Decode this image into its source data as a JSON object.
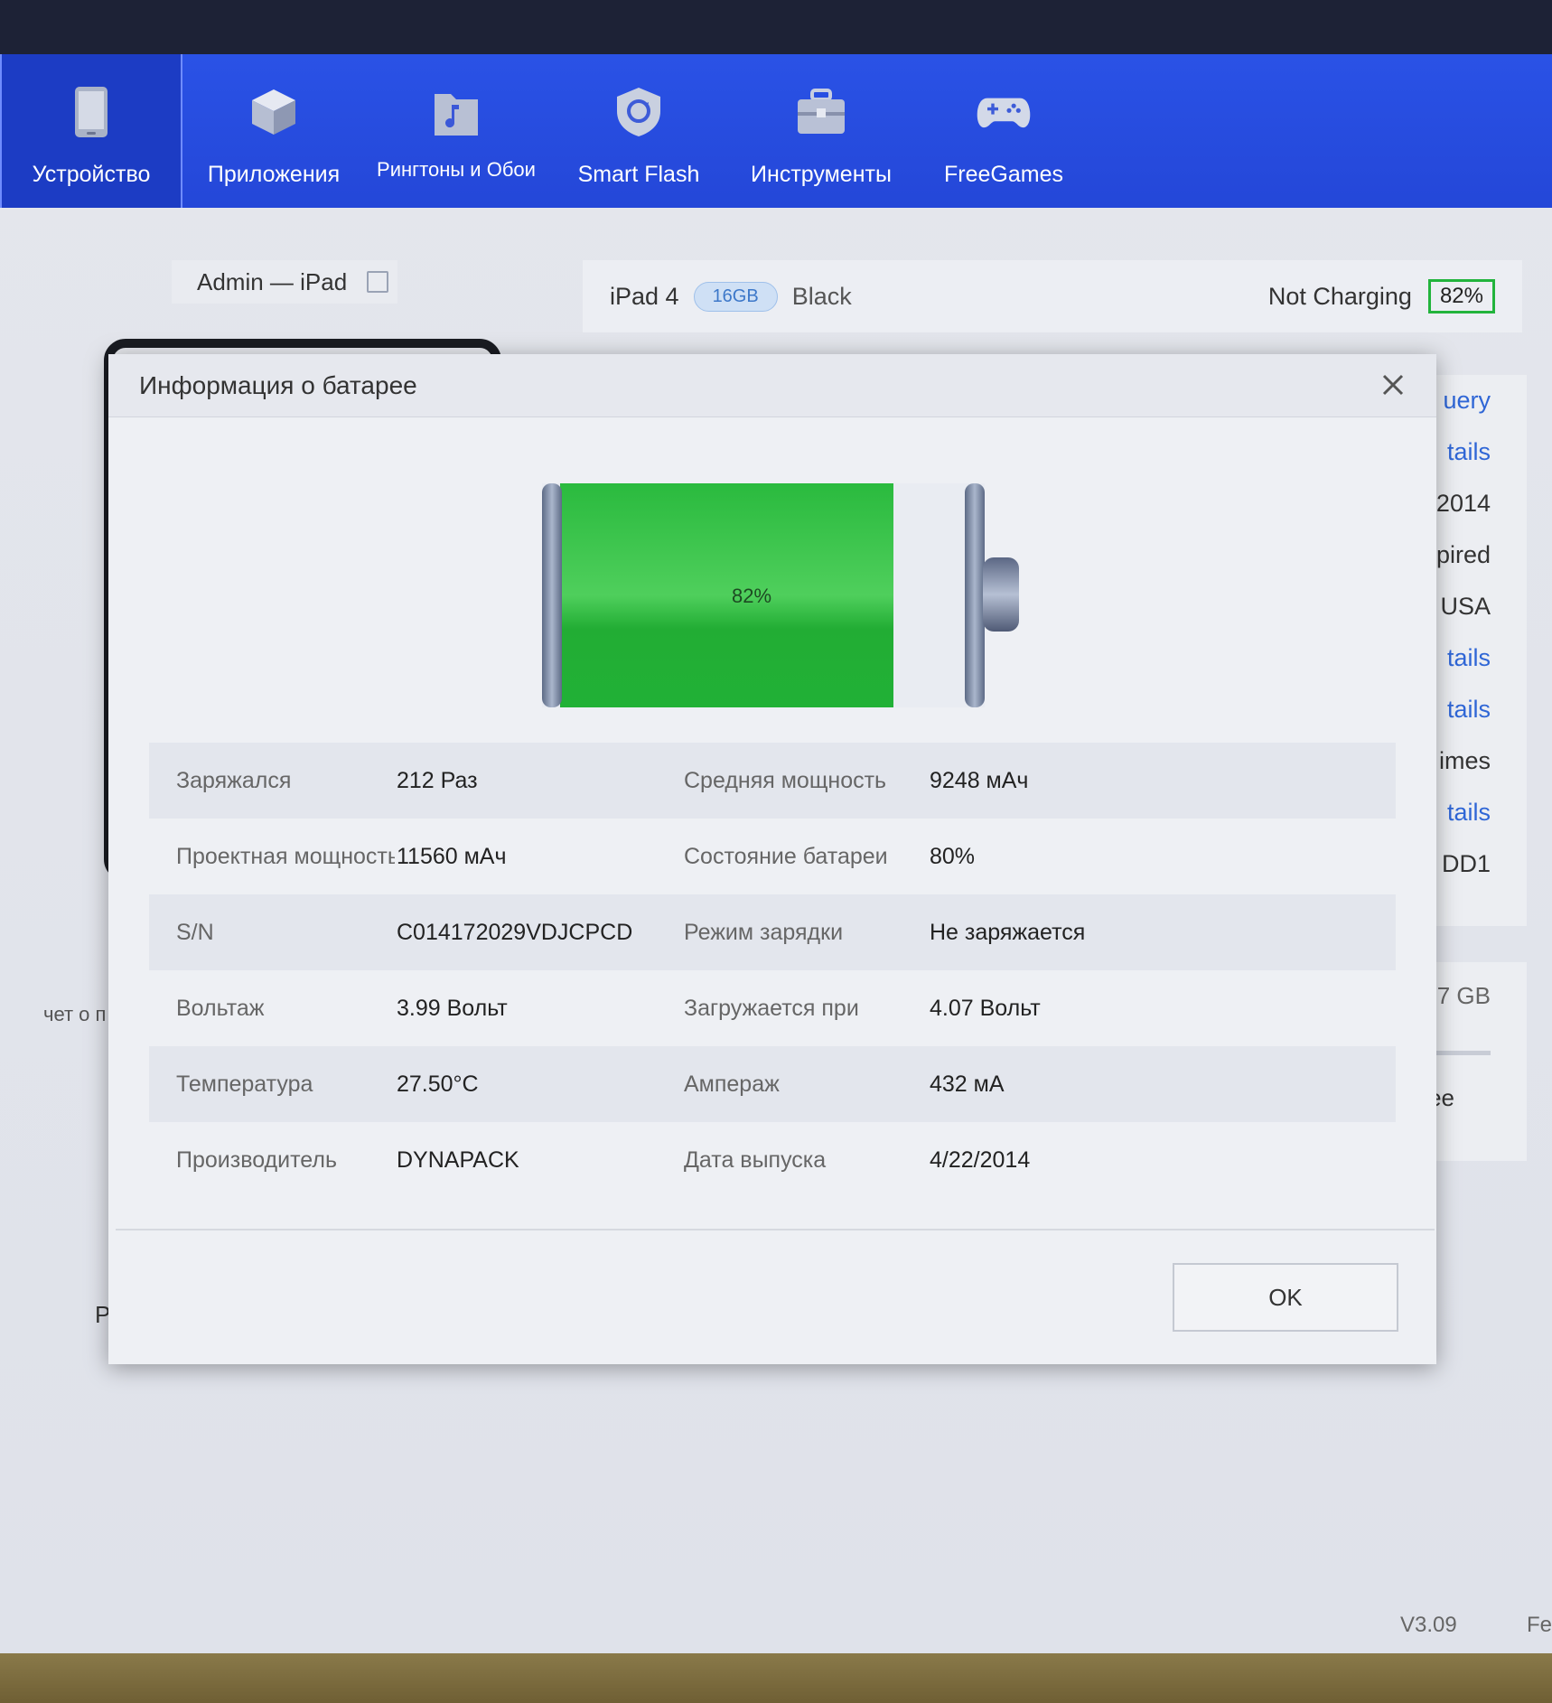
{
  "nav": {
    "items": [
      {
        "label": "Устройство",
        "icon": "phone-icon",
        "active": true
      },
      {
        "label": "Приложения",
        "icon": "cube-icon",
        "active": false
      },
      {
        "label": "Рингтоны и Обои",
        "icon": "music-folder-icon",
        "active": false
      },
      {
        "label": "Smart Flash",
        "icon": "flash-shield-icon",
        "active": false
      },
      {
        "label": "Инструменты",
        "icon": "toolbox-icon",
        "active": false
      },
      {
        "label": "FreeGames",
        "icon": "gamepad-icon",
        "active": false
      }
    ]
  },
  "device": {
    "name": "Admin — iPad",
    "model": "iPad 4",
    "capacity": "16GB",
    "color": "Black",
    "charge_status": "Not Charging",
    "battery_percent": "82%"
  },
  "side_list": [
    {
      "text": "uery",
      "link": true
    },
    {
      "text": "tails",
      "link": true
    },
    {
      "text": "2014",
      "link": false
    },
    {
      "text": "pired",
      "link": false
    },
    {
      "text": "USA",
      "link": false
    },
    {
      "text": "tails",
      "link": true
    },
    {
      "text": "tails",
      "link": true
    },
    {
      "text": "imes",
      "link": false
    },
    {
      "text": "tails",
      "link": true
    },
    {
      "text": "DD1",
      "link": false
    }
  ],
  "side_extra": {
    "storage": "7 GB",
    "free": "ee"
  },
  "background_fragments": {
    "left1": "чет о п",
    "left2": "Pe",
    "version": "V3.09",
    "footer": "Fe"
  },
  "modal": {
    "title": "Информация о батарее",
    "battery_level": 0.82,
    "battery_label": "82%",
    "rows": [
      {
        "l1": "Заряжался",
        "v1": "212 Раз",
        "l2": "Средняя мощность",
        "v2": "9248 мАч"
      },
      {
        "l1": "Проектная мощность",
        "v1": "11560 мАч",
        "l2": "Состояние батареи",
        "v2": "80%"
      },
      {
        "l1": "S/N",
        "v1": "C014172029VDJCPCD",
        "l2": "Режим зарядки",
        "v2": "Не заряжается"
      },
      {
        "l1": "Вольтаж",
        "v1": "3.99 Вольт",
        "l2": "Загружается при",
        "v2": "4.07 Вольт"
      },
      {
        "l1": "Температура",
        "v1": "27.50°C",
        "l2": "Ампераж",
        "v2": "432 мА"
      },
      {
        "l1": "Производитель",
        "v1": "DYNAPACK",
        "l2": "Дата выпуска",
        "v2": "4/22/2014"
      }
    ],
    "ok_label": "OK"
  },
  "colors": {
    "nav_bg": "#2447d8",
    "battery_fill": "#22b43c",
    "link": "#2f66d6"
  }
}
